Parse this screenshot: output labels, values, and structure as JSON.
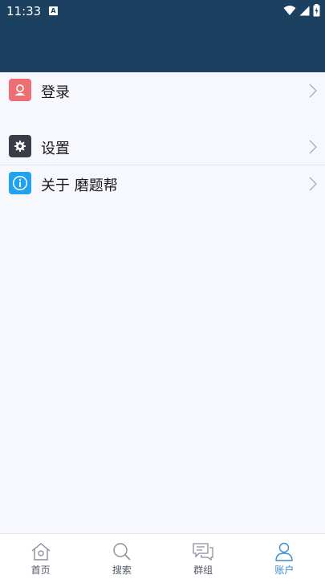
{
  "status_bar": {
    "time": "11:33",
    "badge": "A",
    "icons": [
      "wifi-icon",
      "signal-icon",
      "battery-icon"
    ]
  },
  "menu": {
    "items": [
      {
        "label": "登录",
        "icon": "user-icon",
        "color": "#ee6e73"
      },
      {
        "label": "设置",
        "icon": "gear-icon",
        "color": "#3a3d47"
      },
      {
        "label": "关于 磨题帮",
        "icon": "info-icon",
        "color": "#1fa2f0"
      }
    ]
  },
  "bottom_nav": {
    "items": [
      {
        "label": "首页",
        "icon": "home-icon"
      },
      {
        "label": "搜索",
        "icon": "search-icon"
      },
      {
        "label": "群组",
        "icon": "chat-icon"
      },
      {
        "label": "账户",
        "icon": "account-icon",
        "active": true
      }
    ]
  },
  "colors": {
    "header": "#1b4060",
    "background": "#f7f8fe",
    "accent": "#3d8bd0"
  }
}
